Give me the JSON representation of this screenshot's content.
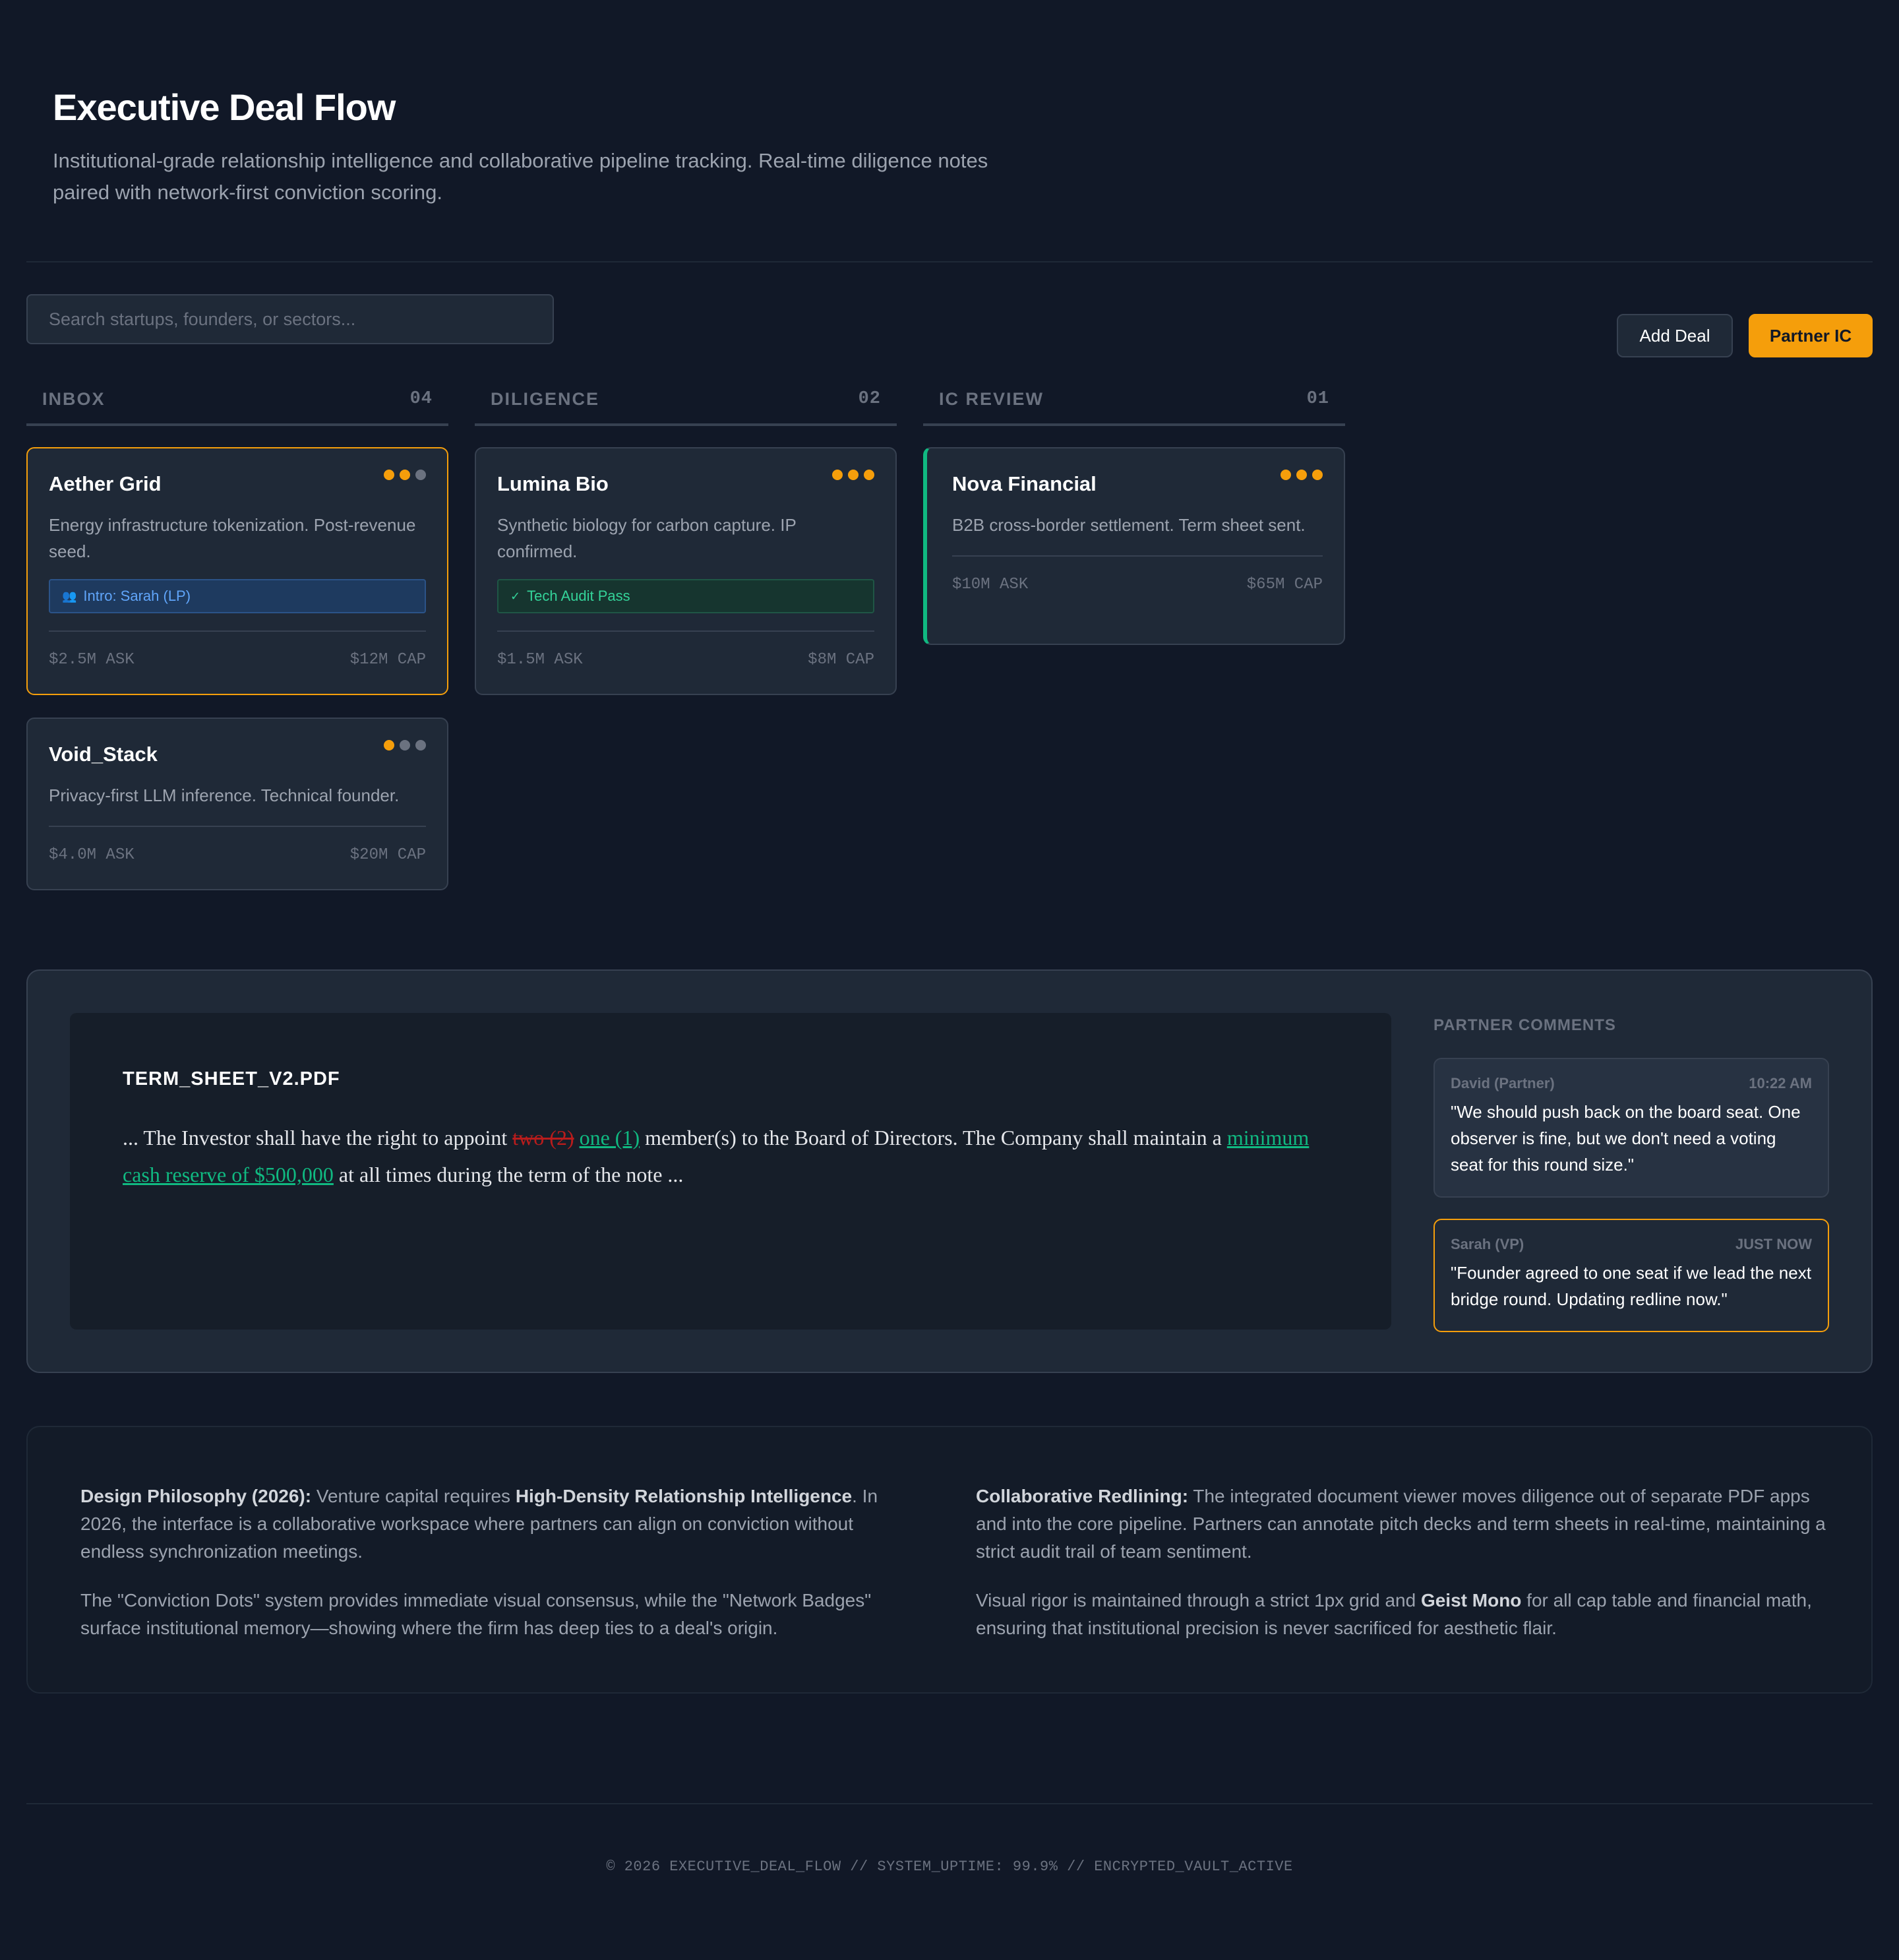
{
  "header": {
    "title": "Executive Deal Flow",
    "subtitle_line1": "Institutional-grade relationship intelligence and collaborative pipeline tracking. Real-time diligence notes",
    "subtitle_line2": "paired with network-first conviction scoring."
  },
  "toolbar": {
    "search_placeholder": "Search startups, founders, or sectors...",
    "add_deal_label": "Add Deal",
    "partner_ic_label": "Partner IC"
  },
  "columns": [
    {
      "title": "INBOX",
      "count": "04",
      "cards": [
        {
          "name": "Aether Grid",
          "desc": "Energy infrastructure tokenization. Post-revenue seed.",
          "badge": "Intro: Sarah (LP)",
          "badge_icon": "people-icon",
          "ask": "$2.5M ASK",
          "cap": "$12M CAP",
          "conviction": 2
        },
        {
          "name": "Void_Stack",
          "desc": "Privacy-first LLM inference. Technical founder.",
          "ask": "$4.0M ASK",
          "cap": "$20M CAP",
          "conviction": 1
        }
      ]
    },
    {
      "title": "DILIGENCE",
      "count": "02",
      "cards": [
        {
          "name": "Lumina Bio",
          "desc": "Synthetic biology for carbon capture. IP confirmed.",
          "badge": "Tech Audit Pass",
          "badge_icon": "check-icon",
          "ask": "$1.5M ASK",
          "cap": "$8M CAP",
          "conviction": 3
        }
      ]
    },
    {
      "title": "IC REVIEW",
      "count": "01",
      "cards": [
        {
          "name": "Nova Financial",
          "desc": "B2B cross-border settlement. Term sheet sent.",
          "ask": "$10M ASK",
          "cap": "$65M CAP",
          "conviction": 3
        }
      ]
    }
  ],
  "document": {
    "filename": "TERM_SHEET_V2.PDF",
    "text_1": "... The Investor shall have the right to appoint ",
    "deleted": "two (2)",
    "inserted_1": "one (1)",
    "text_2": " member(s) to the Board of Directors. The Company shall maintain a ",
    "inserted_2": "minimum cash reserve of $500,000",
    "text_3": " at all times during the term of the note ..."
  },
  "comments": {
    "heading": "PARTNER COMMENTS",
    "items": [
      {
        "author": "David (Partner)",
        "time": "10:22 AM",
        "text": "\"We should push back on the board seat. One observer is fine, but we don't need a voting seat for this round size.\""
      },
      {
        "author": "Sarah (VP)",
        "time": "JUST NOW",
        "text": "\"Founder agreed to one seat if we lead the next bridge round. Updating redline now.\""
      }
    ]
  },
  "philosophy": {
    "p1_bold": "Design Philosophy (2026):",
    "p1_a": " Venture capital requires ",
    "p1_bold2": "High-Density Relationship Intelligence",
    "p1_b": ". In 2026, the interface is a collaborative workspace where partners can align on conviction without endless synchronization meetings.",
    "p2": "The \"Conviction Dots\" system provides immediate visual consensus, while the \"Network Badges\" surface institutional memory—showing where the firm has deep ties to a deal's origin.",
    "p3_bold": "Collaborative Redlining:",
    "p3": " The integrated document viewer moves diligence out of separate PDF apps and into the core pipeline. Partners can annotate pitch decks and term sheets in real-time, maintaining a strict audit trail of team sentiment.",
    "p4_a": "Visual rigor is maintained through a strict 1px grid and ",
    "p4_bold": "Geist Mono",
    "p4_b": " for all cap table and financial math, ensuring that institutional precision is never sacrificed for aesthetic flair."
  },
  "footer": "© 2026 EXECUTIVE_DEAL_FLOW // SYSTEM_UPTIME: 99.9% // ENCRYPTED_VAULT_ACTIVE",
  "colors": {
    "background": "#111827",
    "card": "#1f2937",
    "accent": "#f59e0b",
    "success": "#10b981",
    "info": "#60a5fa",
    "danger": "#b91c1c"
  }
}
